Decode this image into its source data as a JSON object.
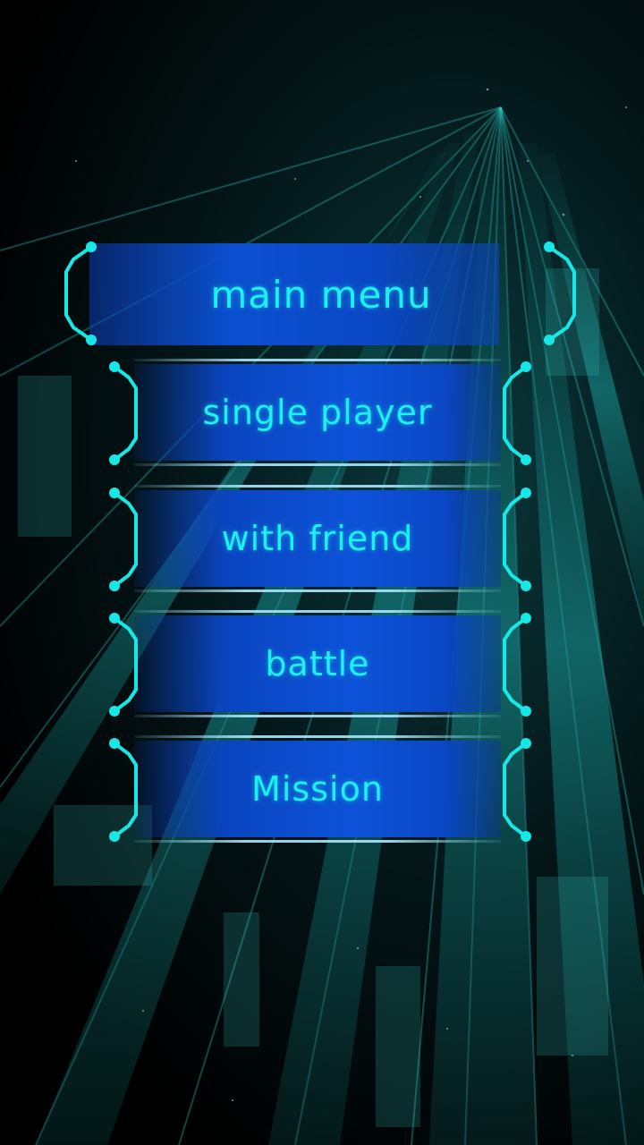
{
  "menu": {
    "title": "main menu",
    "items": [
      {
        "label": "single player",
        "name": "single-player-button"
      },
      {
        "label": "with friend",
        "name": "with-friend-button"
      },
      {
        "label": "battle",
        "name": "battle-button"
      },
      {
        "label": "Mission",
        "name": "mission-button"
      }
    ]
  },
  "colors": {
    "text": "#1ef0f0",
    "bracket": "#16e8e8",
    "panel": "#0b4fd0"
  }
}
